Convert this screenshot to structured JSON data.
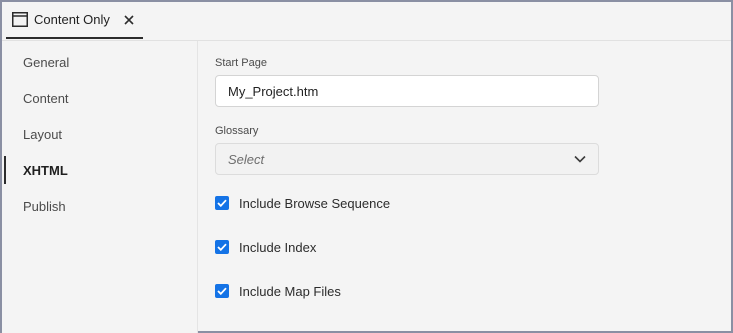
{
  "tab": {
    "title": "Content Only",
    "icon": "window-icon"
  },
  "sidebar": {
    "items": [
      {
        "label": "General"
      },
      {
        "label": "Content"
      },
      {
        "label": "Layout"
      },
      {
        "label": "XHTML",
        "selected": true
      },
      {
        "label": "Publish"
      }
    ]
  },
  "main": {
    "start_page": {
      "label": "Start Page",
      "value": "My_Project.htm"
    },
    "glossary": {
      "label": "Glossary",
      "placeholder": "Select"
    },
    "options": [
      {
        "label": "Include Browse Sequence",
        "checked": true
      },
      {
        "label": "Include Index",
        "checked": true
      },
      {
        "label": "Include Map Files",
        "checked": true
      }
    ]
  },
  "colors": {
    "accent": "#1473e6",
    "border": "#8a8fa3",
    "background": "#f4f4f4"
  }
}
